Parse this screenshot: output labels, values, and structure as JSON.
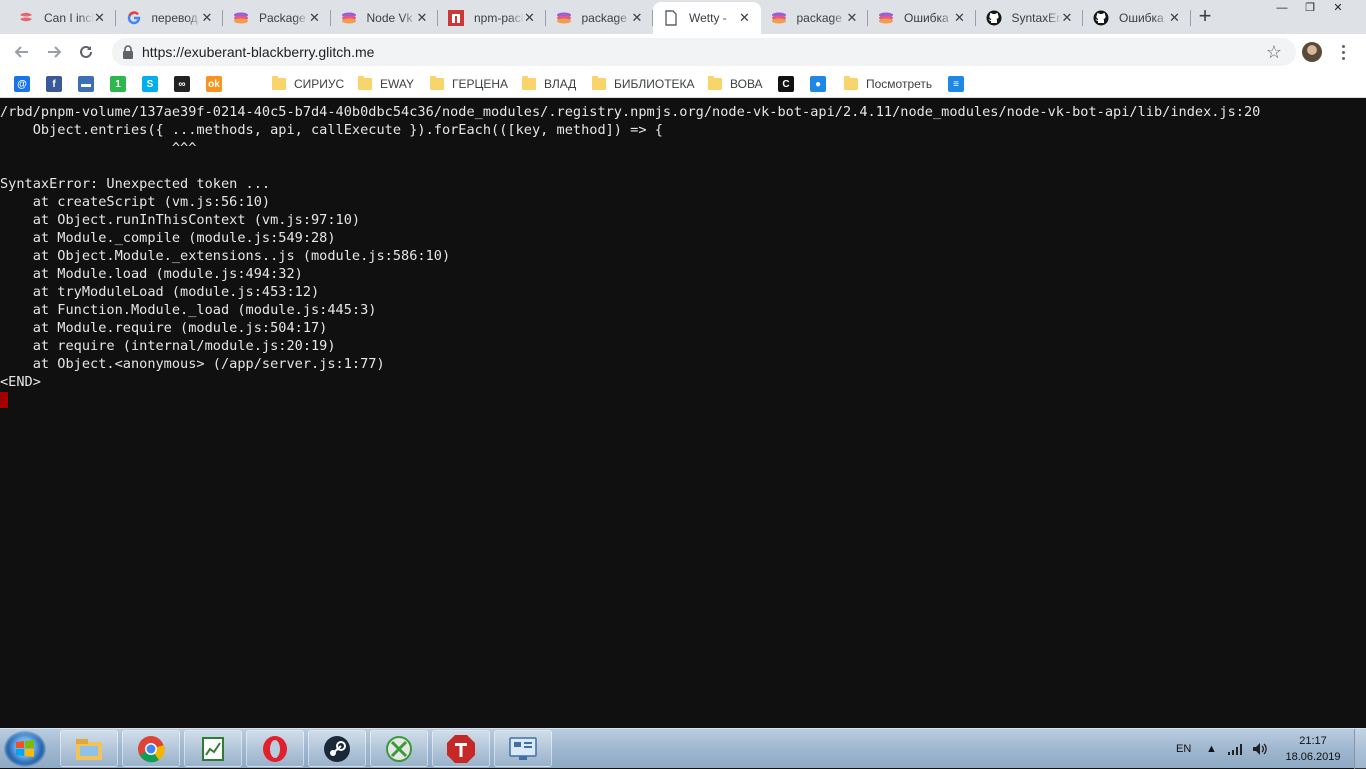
{
  "browser": {
    "tabs": [
      {
        "title": "Can I include",
        "favicon": "caniuse-icon",
        "active": false
      },
      {
        "title": "перевод",
        "favicon": "google-icon",
        "active": false
      },
      {
        "title": "Package",
        "favicon": "stack-icon",
        "active": false
      },
      {
        "title": "Node Vk",
        "favicon": "stack-icon",
        "active": false
      },
      {
        "title": "npm-package",
        "favicon": "npm-icon",
        "active": false
      },
      {
        "title": "package",
        "favicon": "stack-icon",
        "active": false
      },
      {
        "title": "Wetty -",
        "favicon": "page-icon",
        "active": true
      },
      {
        "title": "package",
        "favicon": "stack-icon",
        "active": false
      },
      {
        "title": "Ошибка",
        "favicon": "stack-icon",
        "active": false
      },
      {
        "title": "SyntaxError",
        "favicon": "github-icon",
        "active": false
      },
      {
        "title": "Ошибка",
        "favicon": "github-icon",
        "active": false
      }
    ],
    "new_tab_label": "+",
    "window_controls": {
      "minimize": "—",
      "restore": "❐",
      "close": "✕"
    },
    "url": "https://exuberant-blackberry.glitch.me",
    "bookmarks": [
      {
        "label": "",
        "icon": "mail-icon",
        "color": "#1a73e8"
      },
      {
        "label": "",
        "icon": "facebook-icon",
        "color": "#3b5998"
      },
      {
        "label": "",
        "icon": "chat-icon",
        "color": "#3d6fb4"
      },
      {
        "label": "",
        "icon": "one-icon",
        "color": "#2db84b"
      },
      {
        "label": "",
        "icon": "skype-icon",
        "color": "#00aff0"
      },
      {
        "label": "",
        "icon": "infinity-icon",
        "color": "#222222"
      },
      {
        "label": "",
        "icon": "odnoklassniki-icon",
        "color": "#f7931e"
      },
      {
        "label": "СИРИУС",
        "icon": "folder-icon",
        "color": "#f9d46b"
      },
      {
        "label": "EWAY",
        "icon": "folder-icon",
        "color": "#f9d46b"
      },
      {
        "label": "ГЕРЦЕНА",
        "icon": "folder-icon",
        "color": "#f9d46b"
      },
      {
        "label": "ВЛАД",
        "icon": "folder-icon",
        "color": "#f9d46b"
      },
      {
        "label": "БИБЛИОТЕКА",
        "icon": "folder-icon",
        "color": "#f9d46b"
      },
      {
        "label": "ВОВА",
        "icon": "folder-icon",
        "color": "#f9d46b"
      },
      {
        "label": "",
        "icon": "c-icon",
        "color": "#111111"
      },
      {
        "label": "",
        "icon": "drop-icon",
        "color": "#1e88e5"
      },
      {
        "label": "Посмотреть",
        "icon": "folder-icon",
        "color": "#f9d46b"
      },
      {
        "label": "",
        "icon": "stack-lines-icon",
        "color": "#1e88e5"
      }
    ]
  },
  "terminal": {
    "lines": [
      "/rbd/pnpm-volume/137ae39f-0214-40c5-b7d4-40b0dbc54c36/node_modules/.registry.npmjs.org/node-vk-bot-api/2.4.11/node_modules/node-vk-bot-api/lib/index.js:20",
      "    Object.entries({ ...methods, api, callExecute }).forEach(([key, method]) => {",
      "                     ^^^",
      "",
      "SyntaxError: Unexpected token ...",
      "    at createScript (vm.js:56:10)",
      "    at Object.runInThisContext (vm.js:97:10)",
      "    at Module._compile (module.js:549:28)",
      "    at Object.Module._extensions..js (module.js:586:10)",
      "    at Module.load (module.js:494:32)",
      "    at tryModuleLoad (module.js:453:12)",
      "    at Function.Module._load (module.js:445:3)",
      "    at Module.require (module.js:504:17)",
      "    at require (internal/module.js:20:19)",
      "    at Object.<anonymous> (/app/server.js:1:77)",
      "<END>"
    ],
    "cursor_color": "#a00000"
  },
  "taskbar": {
    "apps": [
      {
        "name": "explorer-icon"
      },
      {
        "name": "chrome-icon"
      },
      {
        "name": "spreadsheet-icon"
      },
      {
        "name": "opera-icon"
      },
      {
        "name": "steam-icon"
      },
      {
        "name": "xbox-icon"
      },
      {
        "name": "t-app-icon"
      },
      {
        "name": "control-panel-icon"
      }
    ],
    "language": "EN",
    "time": "21:17",
    "date": "18.06.2019"
  }
}
